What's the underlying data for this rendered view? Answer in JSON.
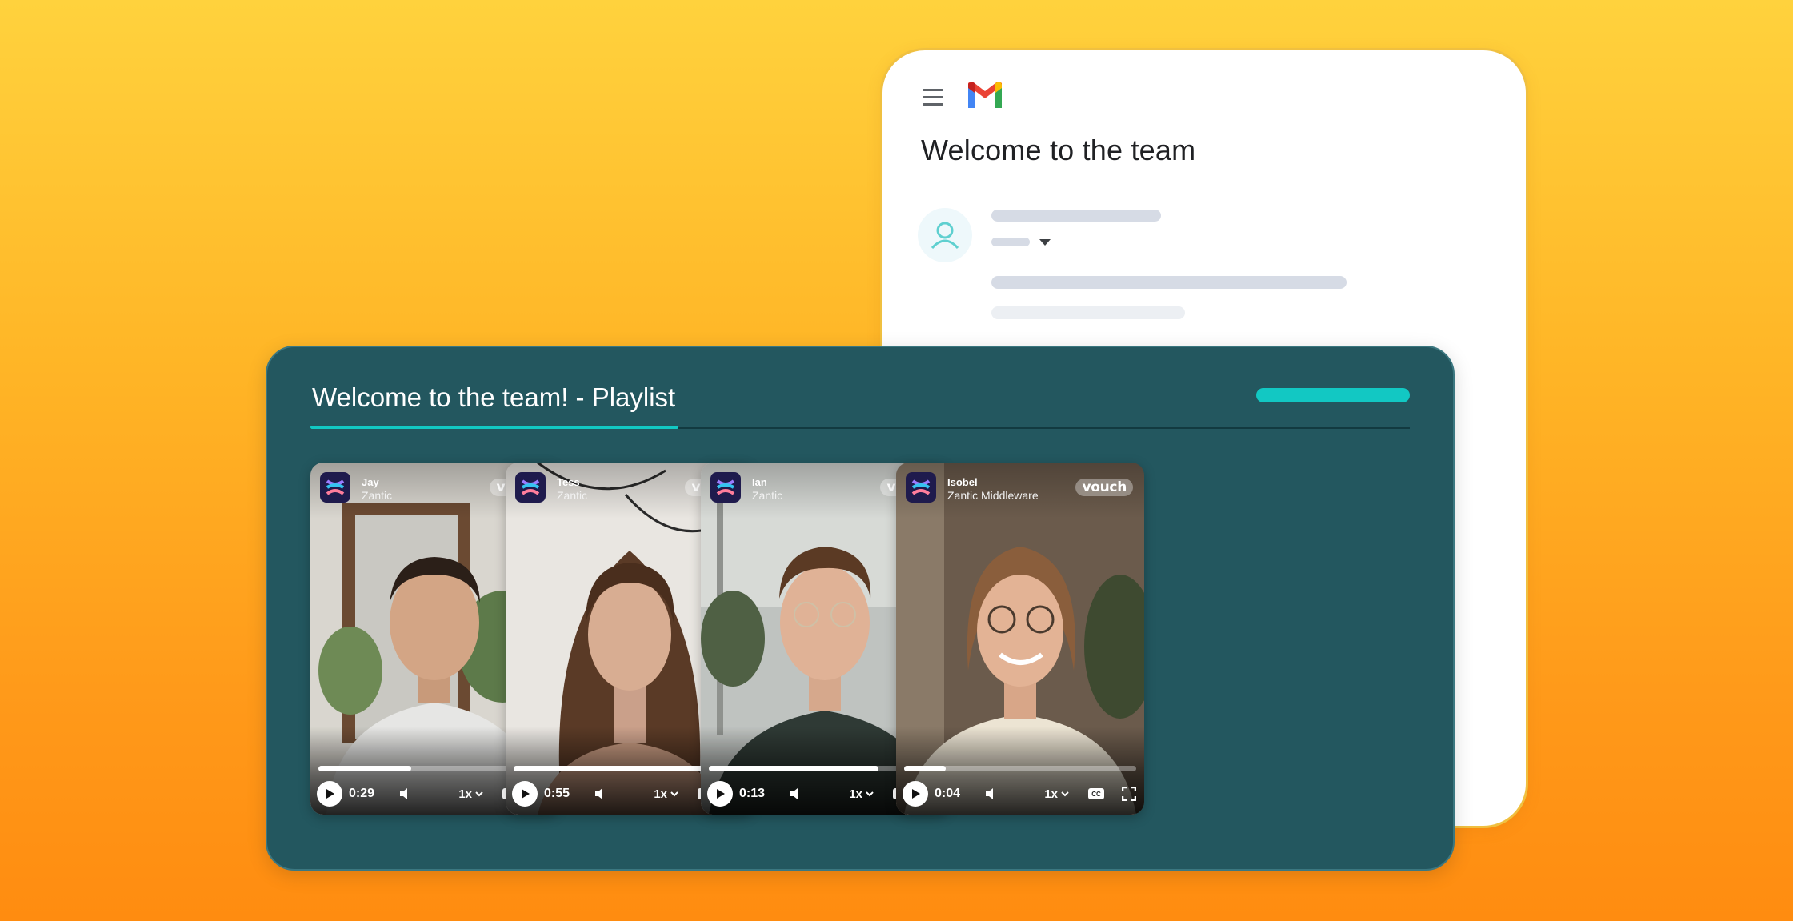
{
  "gmail": {
    "title": "Welcome to the team",
    "icons": [
      "menu-icon",
      "gmail-logo",
      "user-avatar-icon",
      "dropdown-caret-icon"
    ]
  },
  "playlist": {
    "title": "Welcome to the team! - Playlist",
    "accent_color": "#12c8c3",
    "panel_color": "#23575f",
    "videos": [
      {
        "name": "Jay",
        "company": "Zantic",
        "brand_badge": "vouch",
        "time": "0:29",
        "speed": "1x",
        "progress": 0.4
      },
      {
        "name": "Tess",
        "company": "Zantic",
        "brand_badge": "vouch",
        "time": "0:55",
        "speed": "1x",
        "progress": 0.9
      },
      {
        "name": "Ian",
        "company": "Zantic",
        "brand_badge": "vouch",
        "time": "0:13",
        "speed": "1x",
        "progress": 0.73
      },
      {
        "name": "Isobel",
        "company": "Zantic Middleware",
        "brand_badge": "vouch",
        "time": "0:04",
        "speed": "1x",
        "progress": 0.18
      }
    ]
  }
}
